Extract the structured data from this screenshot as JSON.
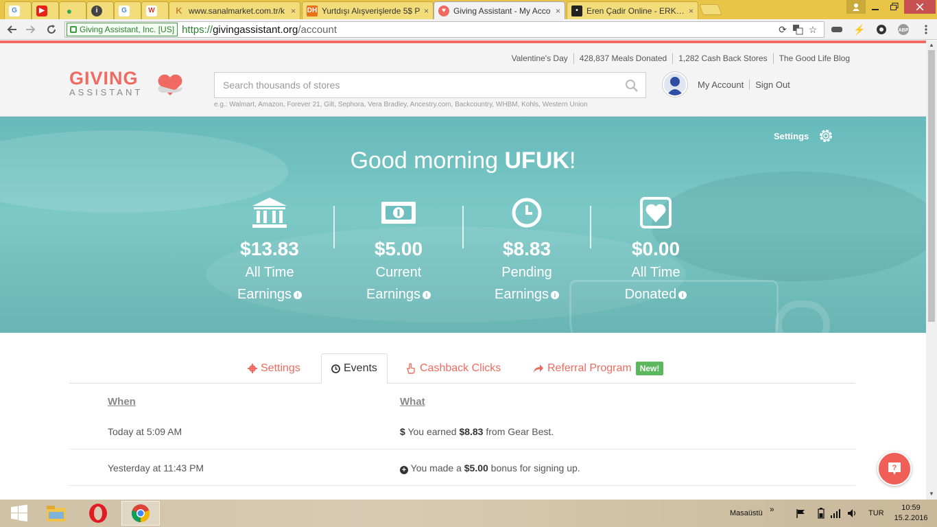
{
  "browser": {
    "tabs": [
      {
        "title": "",
        "icon": "google-icon",
        "color": "#4285f4"
      },
      {
        "title": "",
        "icon": "youtube-icon",
        "color": "#e62117"
      },
      {
        "title": "",
        "icon": "drop-icon",
        "color": "#3aa757"
      },
      {
        "title": "",
        "icon": "info-icon",
        "color": "#444444"
      },
      {
        "title": "",
        "icon": "google-icon",
        "color": "#4285f4"
      },
      {
        "title": "",
        "icon": "wheat-icon",
        "color": "#d0392b"
      },
      {
        "title": "www.sanalmarket.com.tr/k",
        "icon": "kangaroo-icon",
        "color": "#c0873f"
      },
      {
        "title": "Yurtdışı Alışverişlerde 5$ P",
        "icon": "dh-icon",
        "color": "#e8711a"
      },
      {
        "title": "Giving Assistant - My Acco",
        "icon": "giving-assistant-icon",
        "color": "#ef6b61"
      },
      {
        "title": "Eren Çadir Online - ERKEK",
        "icon": "eren-icon",
        "color": "#222222"
      }
    ],
    "close_glyph": "×",
    "ev_cert": "Giving Assistant, Inc. [US]",
    "url_scheme": "https://",
    "url_host": "givingassistant.org",
    "url_path": "/account"
  },
  "header": {
    "top_links": [
      "Valentine's Day",
      "428,837 Meals Donated",
      "1,282 Cash Back Stores",
      "The Good Life Blog"
    ],
    "logo_line1": "GIVING",
    "logo_line2": "ASSISTANT",
    "search_placeholder": "Search thousands of stores",
    "search_examples": "e.g.: Walmart, Amazon, Forever 21, Gilt, Sephora, Vera Bradley, Ancestry.com, Backcountry, WHBM, Kohls, Western Union",
    "my_account": "My Account",
    "sign_out": "Sign Out"
  },
  "hero": {
    "settings_label": "Settings",
    "greeting_prefix": "Good morning ",
    "greeting_name": "UFUK",
    "greeting_suffix": "!",
    "stats": [
      {
        "amount": "$13.83",
        "label1": "All Time",
        "label2": "Earnings",
        "icon": "bank-icon"
      },
      {
        "amount": "$5.00",
        "label1": "Current",
        "label2": "Earnings",
        "icon": "money-icon"
      },
      {
        "amount": "$8.83",
        "label1": "Pending",
        "label2": "Earnings",
        "icon": "clock-icon"
      },
      {
        "amount": "$0.00",
        "label1": "All Time",
        "label2": "Donated",
        "icon": "heart-icon"
      }
    ],
    "info_glyph": "i"
  },
  "tabs": {
    "settings": "Settings",
    "events": "Events",
    "cashback": "Cashback Clicks",
    "referral": "Referral Program",
    "new_badge": "New!"
  },
  "events": {
    "col_when": "When",
    "col_what": "What",
    "rows": [
      {
        "when": "Today at 5:09 AM",
        "pre": "You earned ",
        "amount": "$8.83",
        "post": " from Gear Best.",
        "icon": "dollar-icon",
        "glyph": "$"
      },
      {
        "when": "Yesterday at 11:43 PM",
        "pre": "You made a ",
        "amount": "$5.00",
        "post": " bonus for signing up.",
        "icon": "plus-circle-icon",
        "glyph": "+"
      }
    ]
  },
  "taskbar": {
    "desktop_label": "Masaüstü",
    "chevron": "»",
    "lang": "TUR",
    "time": "10:59",
    "date": "15.2.2016"
  }
}
